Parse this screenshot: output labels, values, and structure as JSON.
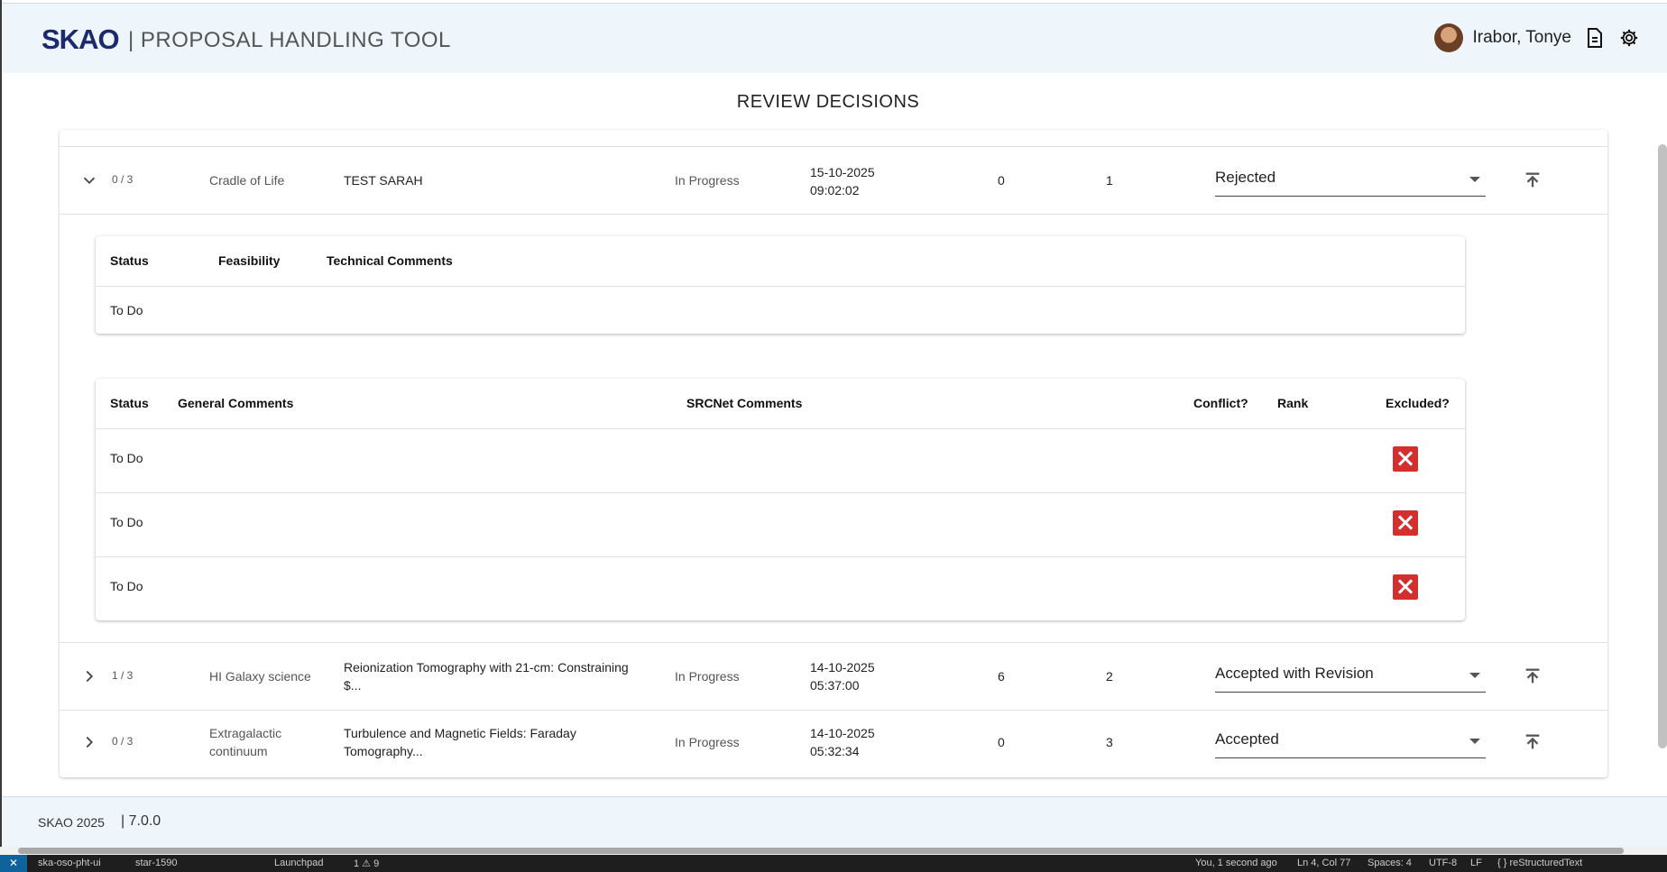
{
  "header": {
    "logo_text": "SKAO",
    "app_title": "| PROPOSAL HANDLING TOOL",
    "user_name": "Irabor, Tonye"
  },
  "page": {
    "title": "REVIEW DECISIONS"
  },
  "rows": [
    {
      "count": "0 / 3",
      "category": "Cradle of Life",
      "title": "TEST SARAH",
      "status": "In Progress",
      "date": "15-10-2025",
      "time": "09:02:02",
      "score": "0",
      "rank": "1",
      "decision": "Rejected"
    },
    {
      "count": "1 / 3",
      "category": "HI Galaxy science",
      "title_line1": "Reionization Tomography with 21-cm: Constraining",
      "title_line2": "$...",
      "status": "In Progress",
      "date": "14-10-2025",
      "time": "05:37:00",
      "score": "6",
      "rank": "2",
      "decision": "Accepted with Revision"
    },
    {
      "count": "0 / 3",
      "category_line1": "Extragalactic",
      "category_line2": "continuum",
      "title_line1": "Turbulence and Magnetic Fields: Faraday",
      "title_line2": "Tomography...",
      "status": "In Progress",
      "date": "14-10-2025",
      "time": "05:32:34",
      "score": "0",
      "rank": "3",
      "decision": "Accepted"
    }
  ],
  "technical_table": {
    "headers": [
      "Status",
      "Feasibility",
      "Technical Comments"
    ],
    "rows": [
      {
        "status": "To Do"
      }
    ]
  },
  "science_table": {
    "headers": [
      "Status",
      "General Comments",
      "SRCNet Comments",
      "Conflict?",
      "Rank",
      "Excluded?"
    ],
    "rows": [
      {
        "status": "To Do"
      },
      {
        "status": "To Do"
      },
      {
        "status": "To Do"
      }
    ]
  },
  "footer": {
    "copyright": "SKAO 2025",
    "version": "| 7.0.0"
  },
  "statusbar": {
    "repo": "ska-oso-pht-ui",
    "branch": "star-1590",
    "launchpad": "Launchpad",
    "problems": "1 ⚠ 9",
    "blame": "You, 1 second ago",
    "position": "Ln 4, Col 77",
    "spaces": "Spaces: 4",
    "encoding": "UTF-8",
    "eol": "LF",
    "language": "{ } reStructuredText"
  },
  "colors": {
    "accent": "#1a2a6c",
    "logo_star": "#e4007c",
    "excluded": "#d32f2f",
    "header_bg": "#eef5fb"
  }
}
